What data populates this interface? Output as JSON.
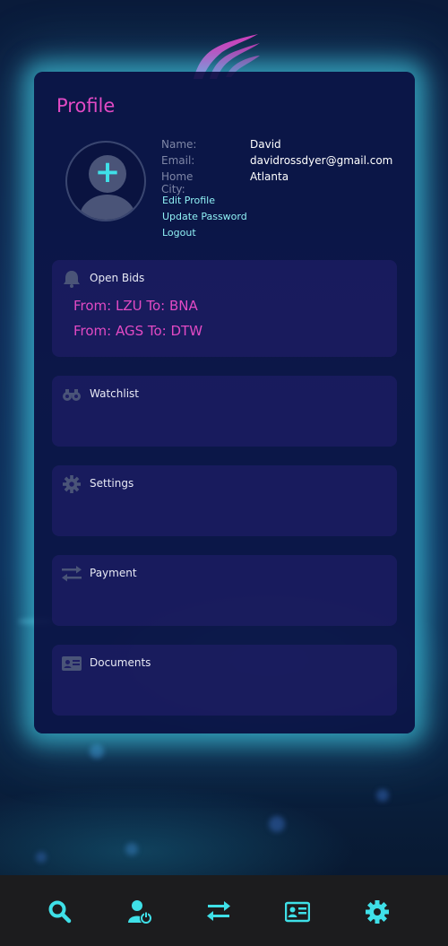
{
  "profile": {
    "title": "Profile",
    "fields": [
      {
        "label": "Name:",
        "value": "David"
      },
      {
        "label": "Email:",
        "value": "davidrossdyer@gmail.com"
      },
      {
        "label": "Home City:",
        "value": "Atlanta"
      }
    ],
    "links": [
      "Edit Profile",
      "Update Password",
      "Logout"
    ]
  },
  "sections": {
    "open_bids": {
      "label": "Open Bids",
      "icon": "bell-icon",
      "items": [
        "From: LZU To: BNA",
        "From: AGS To: DTW"
      ]
    },
    "watchlist": {
      "label": "Watchlist",
      "icon": "binoculars-icon"
    },
    "settings": {
      "label": "Settings",
      "icon": "gear-icon"
    },
    "payment": {
      "label": "Payment",
      "icon": "transfer-arrows-icon"
    },
    "documents": {
      "label": "Documents",
      "icon": "id-card-icon"
    }
  },
  "navbar": {
    "items": [
      {
        "name": "search",
        "icon": "search-icon"
      },
      {
        "name": "profile",
        "icon": "user-power-icon"
      },
      {
        "name": "transfers",
        "icon": "transfer-arrows-icon"
      },
      {
        "name": "documents",
        "icon": "id-card-icon"
      },
      {
        "name": "settings",
        "icon": "gear-icon"
      }
    ]
  },
  "colors": {
    "accent_pink": "#e24ac4",
    "accent_cyan": "#3fe0e8",
    "card_bg": "#0c1648",
    "navbar_bg": "#1c1c1e"
  }
}
